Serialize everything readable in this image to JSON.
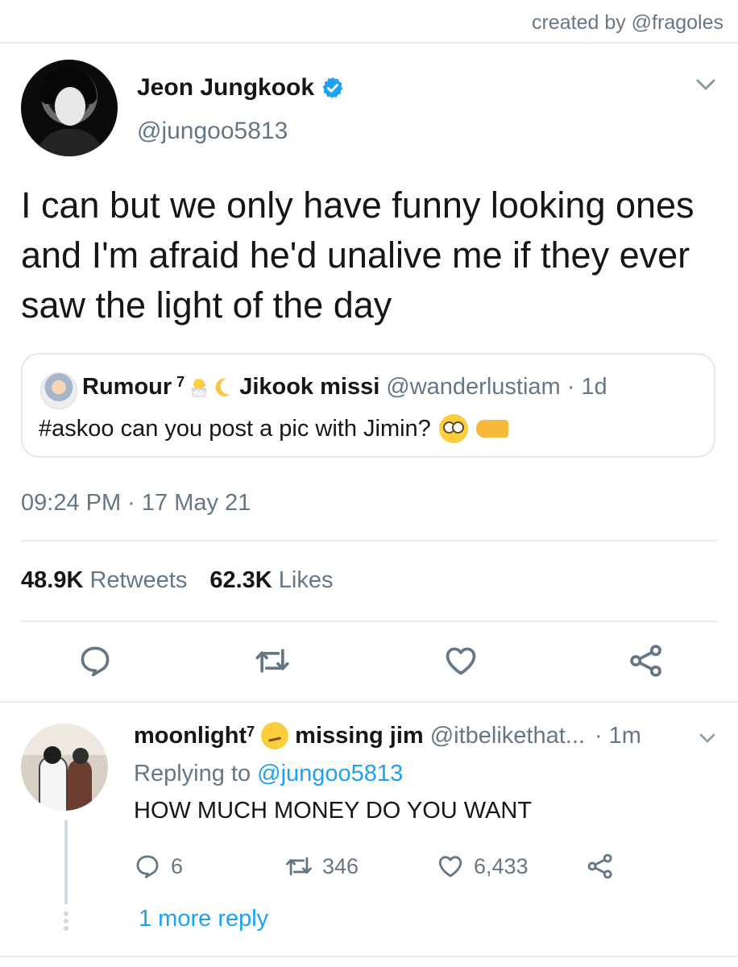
{
  "credit": "created by @fragoles",
  "tweet": {
    "display_name": "Jeon Jungkook",
    "handle": "@jungoo5813",
    "text": "I can but we only have funny looking ones and I'm afraid he'd unalive me if they ever saw the light of the day",
    "timestamp": "09:24 PM · 17 May 21",
    "retweets_count": "48.9K",
    "retweets_label": "Retweets",
    "likes_count": "62.3K",
    "likes_label": "Likes"
  },
  "quote": {
    "name_start": "Rumour",
    "name_sup": "7",
    "name_end": "Jikook missi",
    "handle": "@wanderlustiam",
    "time": "· 1d",
    "text": "#askoo can you post a pic with Jimin?"
  },
  "reply": {
    "name_start": "moonlight",
    "name_sup": "7",
    "name_end": "missing jim",
    "handle": "@itbelikethat...",
    "time": "· 1m",
    "replying_prefix": "Replying to",
    "replying_handle": "@jungoo5813",
    "text": "HOW MUCH MONEY DO YOU WANT",
    "replies_count": "6",
    "retweets_count": "346",
    "likes_count": "6,433",
    "more_replies": "1 more reply"
  },
  "colors": {
    "accent": "#1da1f2",
    "muted": "#657786",
    "divider": "#e6ecf0"
  },
  "icons": [
    "verified-icon",
    "chevron-down-icon",
    "reply-icon",
    "retweet-icon",
    "like-icon",
    "share-icon"
  ]
}
